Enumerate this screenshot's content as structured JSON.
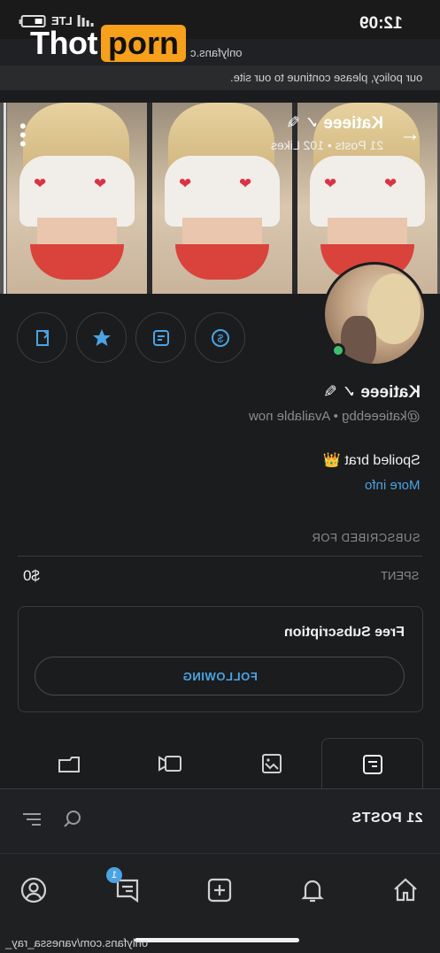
{
  "status": {
    "time": "12:09",
    "network": "LTE"
  },
  "watermark": {
    "part1": "Thot",
    "part2": "porn"
  },
  "browser": {
    "url": "onlyfans.c"
  },
  "policy_text": "our policy, please continue to our site.",
  "header": {
    "name": "Katieee",
    "stats": "21 Posts • 102 Likes"
  },
  "profile": {
    "name": "Katieee",
    "handle": "@katieeebbg • Available now",
    "bio": "Spoiled brat 👑",
    "more_info": "More info"
  },
  "subscription": {
    "section_label": "SUBSCRIBED FOR",
    "spent_label": "SPENT",
    "spent_value": "$0",
    "free_title": "Free Subscription",
    "following_label": "FOLLOWING"
  },
  "posts": {
    "count_label": "21 POSTS"
  },
  "nav": {
    "messages_badge": "1"
  },
  "credit": "onlyfans.com/vanessa_ray_"
}
